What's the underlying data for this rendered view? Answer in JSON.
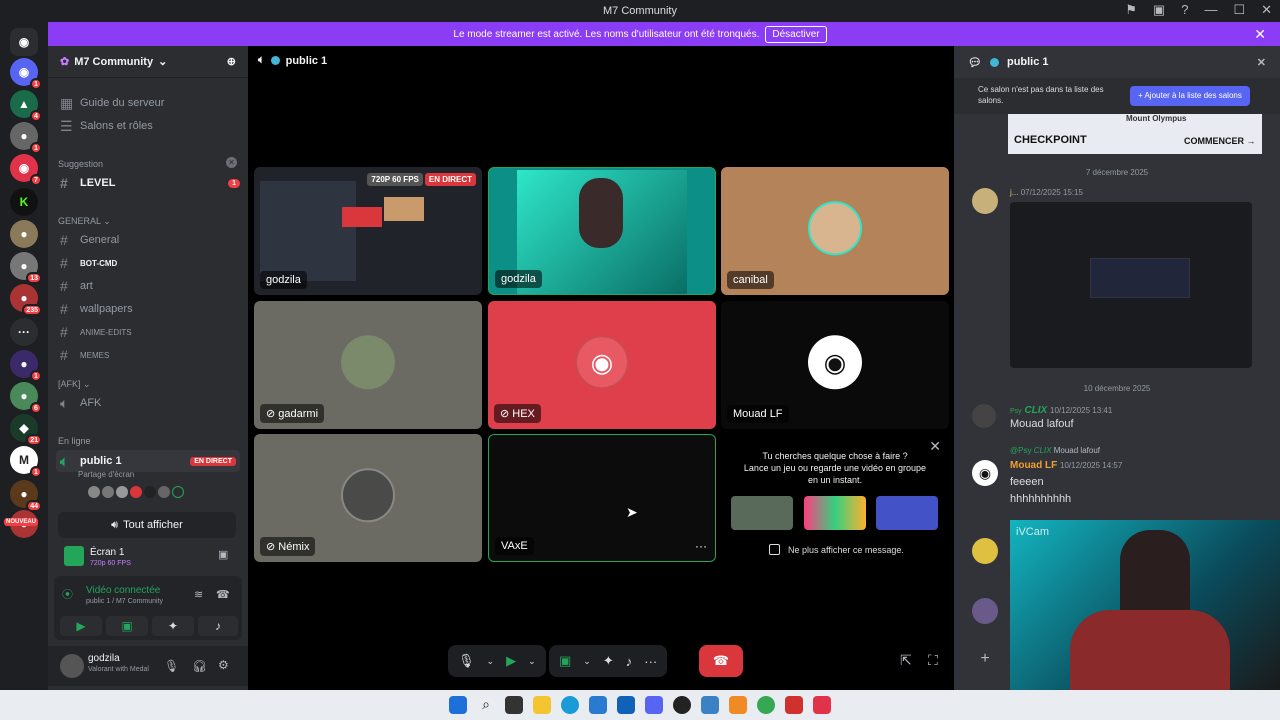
{
  "window": {
    "title": "M7 Community"
  },
  "banner": {
    "text": "Le mode streamer est activé. Les noms d'utilisateur ont été tronqués.",
    "button": "Désactiver"
  },
  "rail": {
    "badges": [
      "1",
      "4",
      "1",
      "7",
      "1",
      "1",
      "1",
      "13",
      "235",
      "1",
      "6",
      "21",
      "1",
      "44",
      "1"
    ],
    "new_label": "NOUVEAU"
  },
  "server": {
    "name": "M7 Community",
    "guide": "Guide du serveur",
    "roles": "Salons et rôles",
    "suggestion_label": "Suggestion",
    "level_channel": "LEVEL",
    "level_badge": "1",
    "general_cat": "GENERAL",
    "channels": [
      "General",
      "BOT-CMD",
      "art",
      "wallpapers",
      "ANIME-EDITS",
      "MEMES"
    ],
    "afk_cat": "[AFK]",
    "afk_channel": "AFK",
    "online_label": "En ligne",
    "voice_channel": "public 1",
    "live_badge": "EN DIRECT",
    "screen_share": "Partage d'écran",
    "show_all": "Tout afficher"
  },
  "stream_panel": {
    "title": "Écran 1",
    "quality": "720p 60 FPS"
  },
  "voice_panel": {
    "status": "Vidéo connectée",
    "location": "public 1 / M7 Community"
  },
  "user": {
    "name": "godzila",
    "activity": "Valorant with Medal"
  },
  "main": {
    "channel": "public 1",
    "tiles": [
      {
        "name": "godzila",
        "tag1": "720P 60 FPS",
        "tag2": "EN DIRECT"
      },
      {
        "name": "godzila"
      },
      {
        "name": "canibal"
      },
      {
        "name": "gadarmi"
      },
      {
        "name": "HEX"
      },
      {
        "name": "Mouad LF"
      },
      {
        "name": "Némix"
      },
      {
        "name": "VAxE"
      }
    ],
    "promo": {
      "line1": "Tu cherches quelque chose à faire ?",
      "line2": "Lance un jeu ou regarde une vidéo en groupe",
      "line3": "en un instant.",
      "checkbox": "Ne plus afficher ce message."
    }
  },
  "right": {
    "channel": "public 1",
    "notice": "Ce salon n'est pas dans ta liste des salons.",
    "add_button": "Ajouter à la liste des salons",
    "ad": {
      "brand": "CHECKPOINT",
      "sub": "Mount Olympus",
      "cta": "COMMENCER"
    },
    "date1": "7 décembre 2025",
    "date2": "10 décembre 2025",
    "msg1": {
      "name": "j...",
      "time": "07/12/2025 15:15"
    },
    "msg2": {
      "prefix": "Psy",
      "name": "CLIX",
      "time": "10/12/2025 13:41",
      "text": "Mouad lafouf"
    },
    "msg3": {
      "reply_prefix": "@Psy",
      "reply_name": "CLIX",
      "reply_text": "Mouad lafouf",
      "name": "Mouad LF",
      "time": "10/12/2025 14:57",
      "line1": "feeeen",
      "line2": "hhhhhhhhhh"
    },
    "webcam_label": "iVCam"
  },
  "colors": {
    "accent": "#5865f2",
    "danger": "#da373c",
    "green": "#23a55a",
    "brand": "#8b3cf5"
  }
}
